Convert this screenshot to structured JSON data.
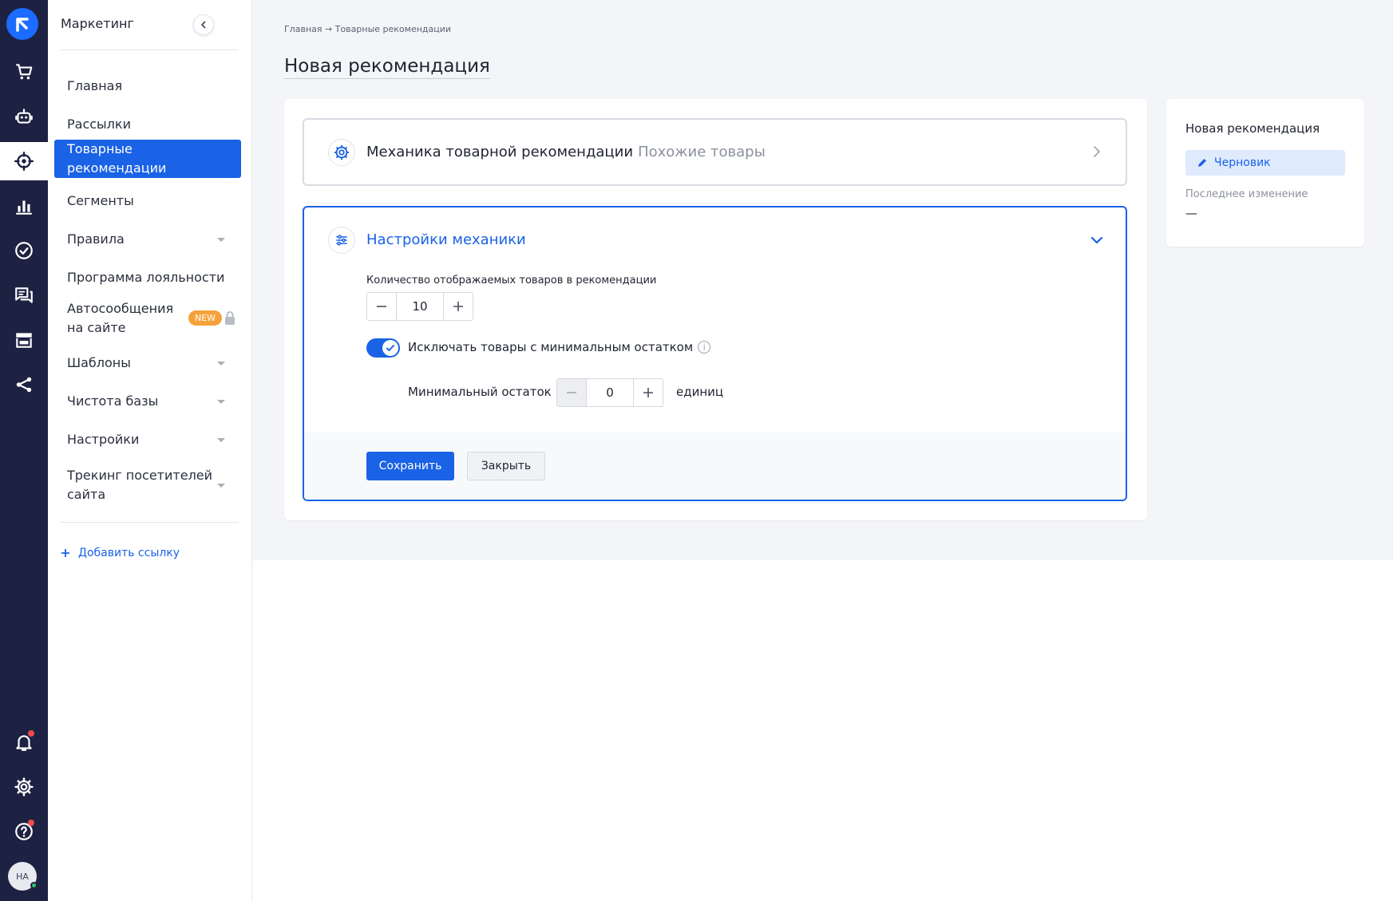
{
  "rail": {
    "items": [
      {
        "icon": "cart-icon"
      },
      {
        "icon": "robot-icon"
      },
      {
        "icon": "target-icon",
        "active": true
      },
      {
        "icon": "bar-chart-icon"
      },
      {
        "icon": "check-circle-icon"
      },
      {
        "icon": "chat-icon"
      },
      {
        "icon": "store-icon"
      },
      {
        "icon": "share-icon"
      }
    ],
    "bottom": [
      {
        "icon": "bell-icon",
        "has_dot": true
      },
      {
        "icon": "gear-icon"
      },
      {
        "icon": "help-icon",
        "has_dot": true
      }
    ],
    "avatar_text": "HA"
  },
  "sidebar": {
    "title": "Маркетинг",
    "items": [
      {
        "label": "Главная"
      },
      {
        "label": "Рассылки"
      },
      {
        "label": "Товарные рекомендации",
        "active": true
      },
      {
        "label": "Сегменты"
      },
      {
        "label": "Правила",
        "has_caret": true
      },
      {
        "label": "Программа лояльности"
      },
      {
        "label_line1": "Автосообщения",
        "label_line2": "на сайте",
        "badge": "NEW",
        "locked": true
      },
      {
        "label": "Шаблоны",
        "has_caret": true
      },
      {
        "label": "Чистота базы",
        "has_caret": true
      },
      {
        "label": "Настройки",
        "has_caret": true
      },
      {
        "label_line1": "Трекинг посетителей",
        "label_line2": "сайта",
        "has_caret": true
      }
    ],
    "add_link": "Добавить ссылку"
  },
  "breadcrumb": {
    "home": "Главная",
    "separator": "→",
    "current": "Товарные рекомендации"
  },
  "page_title": "Новая рекомендация",
  "mechanics_section": {
    "title": "Механика товарной рекомендации",
    "subtitle": "Похожие товары"
  },
  "settings_section": {
    "title": "Настройки механики",
    "count_label": "Количество отображаемых товаров в рекомендации",
    "count_value": "10",
    "exclude_toggle_label": "Исключать товары с минимальным остатком",
    "exclude_toggle_on": true,
    "min_stock_label": "Минимальный остаток",
    "min_stock_value": "0",
    "min_stock_units": "единиц",
    "save_label": "Сохранить",
    "close_label": "Закрыть"
  },
  "status_card": {
    "title": "Новая рекомендация",
    "status": "Черновик",
    "last_changed_label": "Последнее изменение",
    "last_changed_value": "—"
  },
  "colors": {
    "rail_bg": "#1d2243",
    "accent": "#1a62e6",
    "badge_new": "#f5a23a",
    "page_bg": "#f4f5f8"
  }
}
